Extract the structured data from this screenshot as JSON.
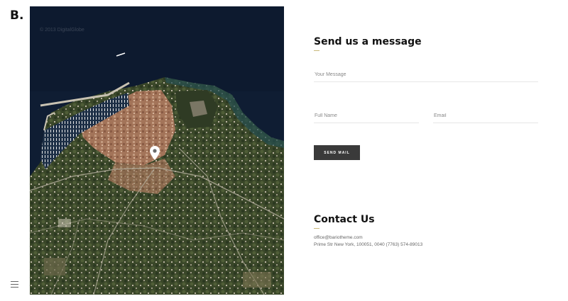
{
  "brand": {
    "logo": "B."
  },
  "message_form": {
    "title": "Send us a message",
    "message_placeholder": "Your Message",
    "name_placeholder": "Full Name",
    "email_placeholder": "Email",
    "send_label": "SEND MAIL"
  },
  "contact": {
    "title": "Contact Us",
    "email": "office@bariotheme.com",
    "address": "Prime Str New York, 100051, 0040 (7763) 574-89013"
  },
  "map": {
    "watermark": "© 2013 DigitalGlobe",
    "accent_colors": {
      "water": "#0f1d33",
      "town": "#b98a6d",
      "vegetation": "#3d4b2c"
    }
  },
  "icons": {
    "menu": "hamburger-icon",
    "pin": "map-pin-icon"
  }
}
